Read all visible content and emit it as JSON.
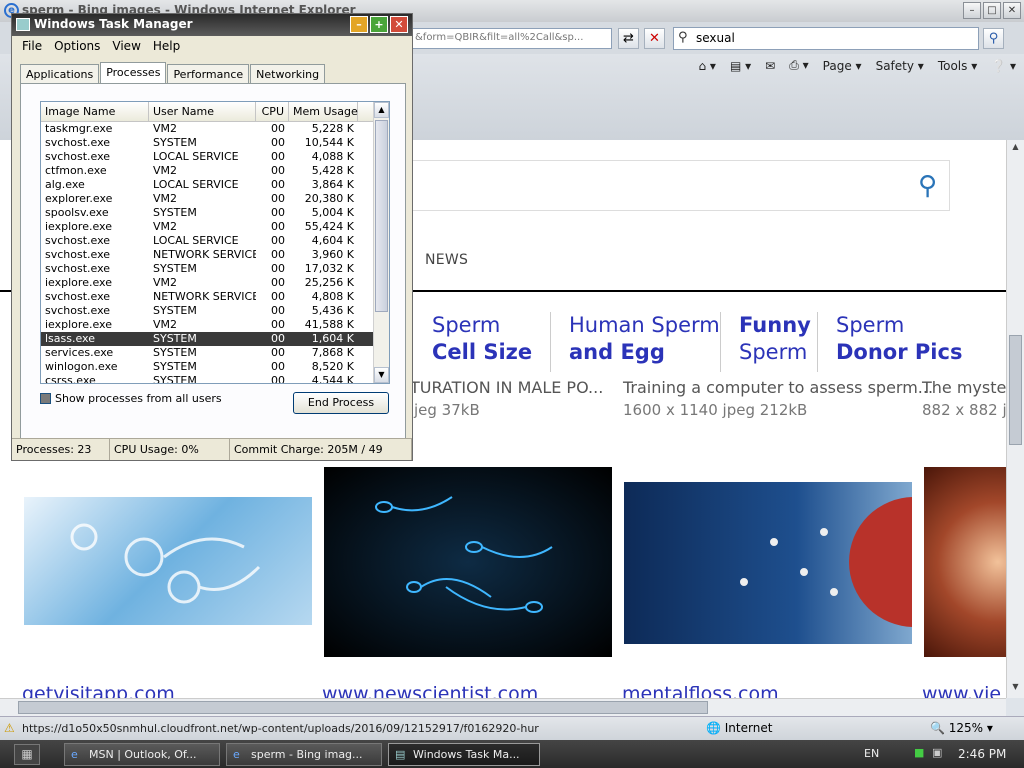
{
  "ie": {
    "title": "sperm - Bing images - Windows Internet Explorer",
    "address": "&form=QBIR&filt=all%2Call&sp...",
    "search_value": "sexual",
    "commands": [
      "Page",
      "Safety",
      "Tools"
    ],
    "status_url": "https://d1o50x50snmhul.cloudfront.net/wp-content/uploads/2016/09/12152917/f0162920-hur",
    "zone": "Internet",
    "zoom": "125%"
  },
  "bing": {
    "tab_news": "NEWS",
    "related": [
      {
        "line1": "Sperm",
        "line2": "Cell Size"
      },
      {
        "line1": "Human Sperm",
        "line2": "and Egg"
      },
      {
        "line1": "Funny",
        "line2": "Sperm"
      },
      {
        "line1": "Sperm",
        "line2": "Donor Pics"
      }
    ],
    "captions": [
      {
        "title": "TURATION IN MALE PO...",
        "meta": "jeg 37kB"
      },
      {
        "title": "Training a computer to assess sperm...",
        "meta": "1600 x 1140 jpeg 212kB"
      },
      {
        "title": "The myster",
        "meta": "882 x 882 jp"
      }
    ],
    "sources": [
      "getvisitapp.com",
      "www.newscientist.com",
      "mentalfloss.com",
      "www.vie"
    ]
  },
  "taskmanager": {
    "title": "Windows Task Manager",
    "menu": [
      "File",
      "Options",
      "View",
      "Help"
    ],
    "tabs": [
      "Applications",
      "Processes",
      "Performance",
      "Networking"
    ],
    "columns": [
      "Image Name",
      "User Name",
      "CPU",
      "Mem Usage"
    ],
    "processes": [
      [
        "taskmgr.exe",
        "VM2",
        "00",
        "5,228 K"
      ],
      [
        "svchost.exe",
        "SYSTEM",
        "00",
        "10,544 K"
      ],
      [
        "svchost.exe",
        "LOCAL SERVICE",
        "00",
        "4,088 K"
      ],
      [
        "ctfmon.exe",
        "VM2",
        "00",
        "5,428 K"
      ],
      [
        "alg.exe",
        "LOCAL SERVICE",
        "00",
        "3,864 K"
      ],
      [
        "explorer.exe",
        "VM2",
        "00",
        "20,380 K"
      ],
      [
        "spoolsv.exe",
        "SYSTEM",
        "00",
        "5,004 K"
      ],
      [
        "iexplore.exe",
        "VM2",
        "00",
        "55,424 K"
      ],
      [
        "svchost.exe",
        "LOCAL SERVICE",
        "00",
        "4,604 K"
      ],
      [
        "svchost.exe",
        "NETWORK SERVICE",
        "00",
        "3,960 K"
      ],
      [
        "svchost.exe",
        "SYSTEM",
        "00",
        "17,032 K"
      ],
      [
        "iexplore.exe",
        "VM2",
        "00",
        "25,256 K"
      ],
      [
        "svchost.exe",
        "NETWORK SERVICE",
        "00",
        "4,808 K"
      ],
      [
        "svchost.exe",
        "SYSTEM",
        "00",
        "5,436 K"
      ],
      [
        "iexplore.exe",
        "VM2",
        "00",
        "41,588 K"
      ],
      [
        "lsass.exe",
        "SYSTEM",
        "00",
        "1,604 K"
      ],
      [
        "services.exe",
        "SYSTEM",
        "00",
        "7,868 K"
      ],
      [
        "winlogon.exe",
        "SYSTEM",
        "00",
        "8,520 K"
      ],
      [
        "csrss.exe",
        "SYSTEM",
        "00",
        "4,544 K"
      ]
    ],
    "selected_index": 15,
    "show_all_label": "Show processes from all users",
    "end_process_label": "End Process",
    "status": [
      "Processes: 23",
      "CPU Usage: 0%",
      "Commit Charge: 205M / 49"
    ]
  },
  "taskbar": {
    "buttons": [
      "MSN | Outlook, Of...",
      "sperm - Bing imag...",
      "Windows Task Ma..."
    ],
    "language": "EN",
    "clock": "2:46 PM"
  }
}
